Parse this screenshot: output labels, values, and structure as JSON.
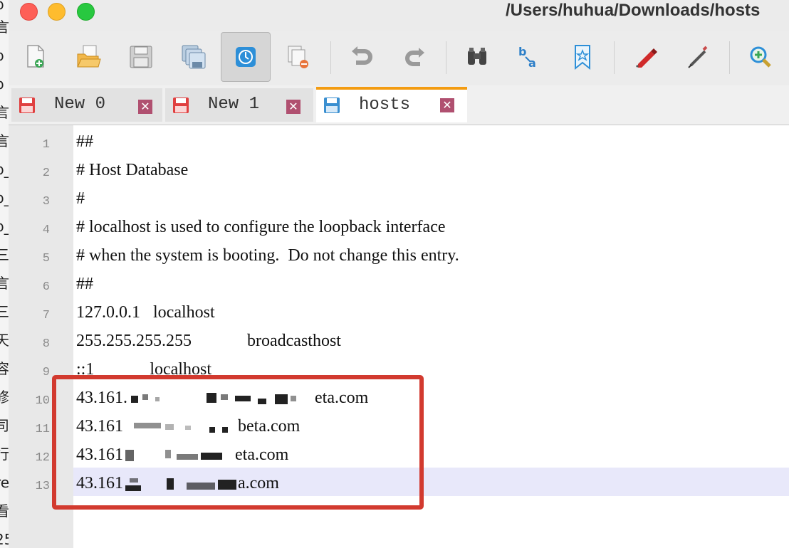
{
  "window": {
    "title": "/Users/huhua/Downloads/hosts",
    "traffic_lights": {
      "close": "#fe5f57",
      "minimize": "#febc2e",
      "zoom": "#28c840"
    }
  },
  "background_app": {
    "visible_chars": [
      "p",
      "言",
      "p",
      "p",
      "言",
      "言",
      "p_",
      "p_",
      "p_",
      "三",
      "言",
      "三",
      "天",
      "容",
      "修",
      "司",
      "行",
      "re",
      "看",
      "25"
    ]
  },
  "toolbar": {
    "buttons": [
      {
        "name": "new-file",
        "icon": "new-file-icon"
      },
      {
        "name": "open-file",
        "icon": "open-folder-icon"
      },
      {
        "name": "save",
        "icon": "save-icon"
      },
      {
        "name": "save-all",
        "icon": "save-all-icon"
      },
      {
        "name": "monitor",
        "icon": "monitor-icon",
        "active": true
      },
      {
        "name": "close",
        "icon": "close-file-icon"
      },
      {
        "name": "undo",
        "icon": "undo-icon"
      },
      {
        "name": "redo",
        "icon": "redo-icon"
      },
      {
        "name": "find",
        "icon": "binoculars-icon"
      },
      {
        "name": "replace",
        "icon": "replace-icon"
      },
      {
        "name": "bookmark",
        "icon": "bookmark-icon"
      },
      {
        "name": "macro-record",
        "icon": "marker-icon"
      },
      {
        "name": "macro-play",
        "icon": "pen-icon"
      },
      {
        "name": "zoom-in",
        "icon": "zoom-in-icon"
      }
    ]
  },
  "tabs": [
    {
      "label": "New 0",
      "active": false,
      "icon_color": "#e04040"
    },
    {
      "label": "New 1",
      "active": false,
      "icon_color": "#e04040"
    },
    {
      "label": "hosts",
      "active": true,
      "icon_color": "#3a8fd0"
    }
  ],
  "colors": {
    "accent_tab": "#f39c12",
    "annotation_box": "#d23a2f",
    "current_line": "#e8e8fa"
  },
  "editor": {
    "current_line": 13,
    "lines": [
      {
        "num": "1",
        "text": "##"
      },
      {
        "num": "2",
        "text": "# Host Database"
      },
      {
        "num": "3",
        "text": "#"
      },
      {
        "num": "4",
        "text": "# localhost is used to configure the loopback interface"
      },
      {
        "num": "5",
        "text": "# when the system is booting.  Do not change this entry."
      },
      {
        "num": "6",
        "text": "##"
      },
      {
        "num": "7",
        "text": "127.0.0.1   localhost"
      },
      {
        "num": "8",
        "text": "255.255.255.255\t\tbroadcasthost"
      },
      {
        "num": "9",
        "text": "::1             localhost"
      },
      {
        "num": "10",
        "pre": "43.161.",
        "post": "eta.com"
      },
      {
        "num": "11",
        "pre": "43.161",
        "post": "beta.com"
      },
      {
        "num": "12",
        "pre": "43.161",
        "post": "eta.com"
      },
      {
        "num": "13",
        "pre": "43.161",
        "post": "a.com"
      }
    ]
  }
}
